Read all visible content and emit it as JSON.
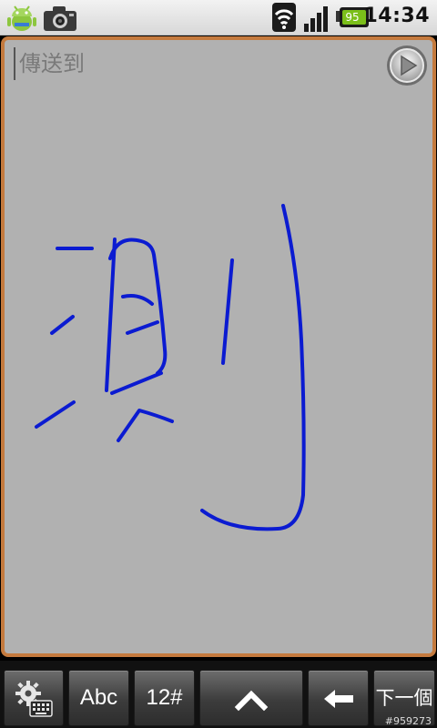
{
  "status_bar": {
    "icons": [
      "android-debug-icon",
      "camera-icon",
      "wifi-icon",
      "signal-icon",
      "battery-icon"
    ],
    "battery_percent": "95",
    "time": "14:34",
    "battery_color": "#7bbf1a"
  },
  "compose": {
    "recipient_placeholder": "傳送到",
    "send_icon": "send-arrow-icon"
  },
  "ink": {
    "stroke_color": "#0b1bd1"
  },
  "toolbar": {
    "settings_icon": "keyboard-settings-icon",
    "abc_label": "Abc",
    "num_label": "12#",
    "shift_icon": "caret-up-icon",
    "backspace_icon": "backspace-arrow-icon",
    "next_label": "下一個",
    "watermark": "#959273"
  }
}
